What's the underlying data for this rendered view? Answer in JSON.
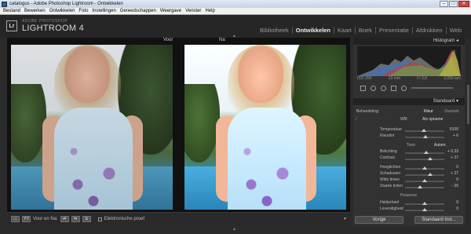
{
  "window": {
    "title": "catalogus - Adobe Photoshop Lightroom - Ontwikkelen"
  },
  "menu": [
    "Bestand",
    "Bewerken",
    "Ontwikkelen",
    "Foto",
    "Instellingen",
    "Gereedschappen",
    "Weergave",
    "Venster",
    "Help"
  ],
  "brand": {
    "small": "ADOBE PHOTOSHOP",
    "name": "LIGHTROOM 4",
    "logo": "Lr"
  },
  "modules": [
    {
      "label": "Bibliotheek",
      "active": false
    },
    {
      "label": "Ontwikkelen",
      "active": true
    },
    {
      "label": "Kaart",
      "active": false
    },
    {
      "label": "Boek",
      "active": false
    },
    {
      "label": "Presentatie",
      "active": false
    },
    {
      "label": "Afdrukken",
      "active": false
    },
    {
      "label": "Web",
      "active": false
    }
  ],
  "viewer": {
    "before_label": "Voor",
    "after_label": "Na"
  },
  "toolbar": {
    "compare_label": "Voor en Na:",
    "softproof_label": "Elektronische proef"
  },
  "panel": {
    "histogram_title": "Histogram",
    "histo_meta": [
      "ISO 200",
      "23 mm",
      "f / 3,8",
      "1/250 sec"
    ],
    "standard_title": "Standaard",
    "treatment_label": "Behandeling:",
    "treatment_color": "Kleur",
    "treatment_bw": "Zwartwit",
    "wb_label": "WB:",
    "wb_value": "Als opname",
    "temp_label": "Temperatuur",
    "temp_value": "5100",
    "tint_label": "Kleurtint",
    "tint_value": "+ 6",
    "tone_title": "Toon",
    "auto_label": "Autom.",
    "exposure_label": "Belichting",
    "exposure_value": "+ 0,33",
    "contrast_label": "Contrast",
    "contrast_value": "+ 27",
    "highlights_label": "Hooglichten",
    "highlights_value": "0",
    "shadows_label": "Schaduwen",
    "shadows_value": "+ 27",
    "whites_label": "Witte tinten",
    "whites_value": "0",
    "blacks_label": "Zwarte tinten",
    "blacks_value": "- 26",
    "presence_title": "Presence",
    "clarity_label": "Helderheid",
    "clarity_value": "0",
    "vibrance_label": "Levendigheid",
    "vibrance_value": "0",
    "prev_button": "Vorige",
    "reset_button": "Standaard inst..."
  },
  "slider_levels": {
    "temp": 0.48,
    "tint": 0.52,
    "exposure": 0.53,
    "contrast": 0.63,
    "highlights": 0.5,
    "shadows": 0.63,
    "whites": 0.5,
    "blacks": 0.37,
    "clarity": 0.5,
    "vibrance": 0.5
  },
  "colors": {
    "accent": "#eeeeee",
    "panel_bg": "#323232",
    "viewer_bg": "#111111"
  }
}
